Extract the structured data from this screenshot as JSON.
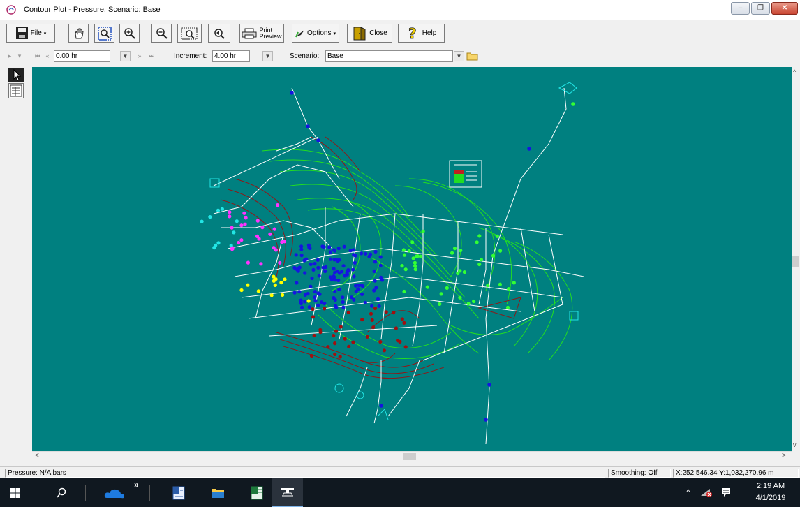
{
  "window": {
    "title": "Contour Plot - Pressure, Scenario: Base",
    "controls": {
      "minimize": "–",
      "maximize": "❐",
      "close": "✕"
    }
  },
  "toolbar": {
    "file_label": "File",
    "print_preview_label_line1": "Print",
    "print_preview_label_line2": "Preview",
    "options_label": "Options",
    "close_label": "Close",
    "help_label": "Help",
    "icons": [
      "save-icon",
      "pan-hand-icon",
      "zoom-extents-icon",
      "zoom-in-icon",
      "zoom-out-icon",
      "zoom-window-icon",
      "zoom-previous-icon",
      "printer-icon",
      "options-icon",
      "door-exit-icon",
      "help-question-icon"
    ]
  },
  "timebar": {
    "time_value": "0.00 hr",
    "increment_label": "Increment:",
    "increment_value": "4.00 hr",
    "scenario_label": "Scenario:",
    "scenario_value": "Base"
  },
  "status": {
    "left": "Pressure: N/A bars",
    "smoothing": "Smoothing: Off",
    "coordinates": "X:252,546.34  Y:1,032,270.96 m"
  },
  "taskbar": {
    "time": "2:19 AM",
    "date": "4/1/2019",
    "overflow_glyph": "»"
  },
  "colors": {
    "canvas": "#008080",
    "contour_green": "#22dd22",
    "contour_dark": "#8b1a1a",
    "node_blue": "#1515e0",
    "node_magenta": "#ff33ff",
    "node_cyan": "#22e5e5",
    "node_yellow": "#ffff00",
    "node_lime": "#33ff33",
    "node_darkred": "#a01010",
    "pipe": "#ffffff"
  }
}
